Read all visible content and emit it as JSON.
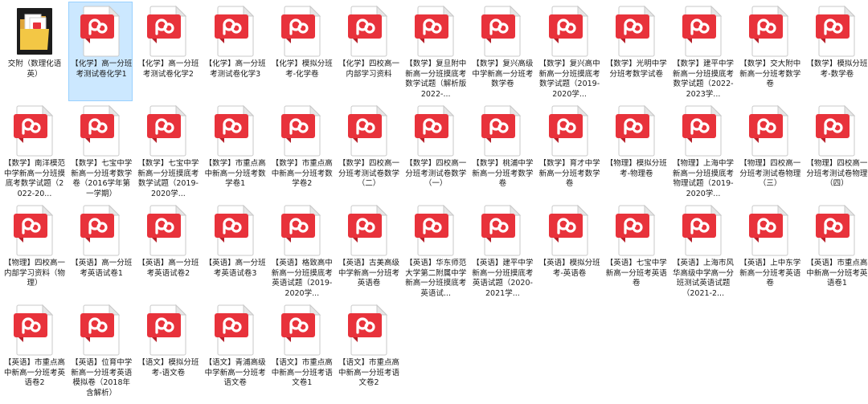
{
  "icons": {
    "folder": "folder-icon",
    "pdf": "pdf-file-icon"
  },
  "colors": {
    "pdf_red": "#e8323b",
    "selection_bg": "#cce8ff",
    "folder_yellow": "#f3c745"
  },
  "items": [
    {
      "label": "交附（数理化语英）",
      "type": "folder",
      "selected": false
    },
    {
      "label": "【化学】高一分班考测试卷化学1",
      "type": "pdf",
      "selected": true
    },
    {
      "label": "【化学】高一分班考测试卷化学2",
      "type": "pdf",
      "selected": false
    },
    {
      "label": "【化学】高一分班考测试卷化学3",
      "type": "pdf",
      "selected": false
    },
    {
      "label": "【化学】模拟分班考-化学卷",
      "type": "pdf",
      "selected": false
    },
    {
      "label": "【化学】四校高一内部学习资料",
      "type": "pdf",
      "selected": false
    },
    {
      "label": "【数学】复旦附中新高一分班摸底考数学试题（解析版2022-...",
      "type": "pdf",
      "selected": false
    },
    {
      "label": "【数学】复兴高级中学新高一分班考数学卷",
      "type": "pdf",
      "selected": false
    },
    {
      "label": "【数学】复兴高中新高一分班摸底考数学试题（2019-2020学...",
      "type": "pdf",
      "selected": false
    },
    {
      "label": "【数学】光明中学分班考数学试卷",
      "type": "pdf",
      "selected": false
    },
    {
      "label": "【数学】建平中学新高一分班摸底考数学试题（2022-2023学...",
      "type": "pdf",
      "selected": false
    },
    {
      "label": "【数学】交大附中新高一分班考数学卷",
      "type": "pdf",
      "selected": false
    },
    {
      "label": "【数学】模拟分班考-数学卷",
      "type": "pdf",
      "selected": false
    },
    {
      "label": "【数学】南洋模范中学新高一分班摸底考数学试题（2022-20...",
      "type": "pdf",
      "selected": false
    },
    {
      "label": "【数学】七宝中学新高一分班考数学卷（2016学年第一学期）",
      "type": "pdf",
      "selected": false
    },
    {
      "label": "【数学】七宝中学新高一分班摸底考数学试题（2019-2020学...",
      "type": "pdf",
      "selected": false
    },
    {
      "label": "【数学】市重点高中新高一分班考数学卷1",
      "type": "pdf",
      "selected": false
    },
    {
      "label": "【数学】市重点高中新高一分班考数学卷2",
      "type": "pdf",
      "selected": false
    },
    {
      "label": "【数学】四校高一分班考测试卷数学（二）",
      "type": "pdf",
      "selected": false
    },
    {
      "label": "【数学】四校高一分班考测试卷数学（一）",
      "type": "pdf",
      "selected": false
    },
    {
      "label": "【数学】桃浦中学新高一分班考数学卷",
      "type": "pdf",
      "selected": false
    },
    {
      "label": "【数学】育才中学新高一分班考数学卷",
      "type": "pdf",
      "selected": false
    },
    {
      "label": "【物理】模拟分班考-物理卷",
      "type": "pdf",
      "selected": false
    },
    {
      "label": "【物理】上海中学新高一分班摸底考物理试题（2019-2020学...",
      "type": "pdf",
      "selected": false
    },
    {
      "label": "【物理】四校高一分班考测试卷物理（三）",
      "type": "pdf",
      "selected": false
    },
    {
      "label": "【物理】四校高一分班考测试卷物理（四）",
      "type": "pdf",
      "selected": false
    },
    {
      "label": "【物理】四校高一内部学习资料（物理）",
      "type": "pdf",
      "selected": false
    },
    {
      "label": "【英语】高一分班考英语试卷1",
      "type": "pdf",
      "selected": false
    },
    {
      "label": "【英语】高一分班考英语试卷2",
      "type": "pdf",
      "selected": false
    },
    {
      "label": "【英语】高一分班考英语试卷3",
      "type": "pdf",
      "selected": false
    },
    {
      "label": "【英语】格致高中新高一分班摸底考英语试题（2019-2020学...",
      "type": "pdf",
      "selected": false
    },
    {
      "label": "【英语】古美高级中学新高一分班考英语卷",
      "type": "pdf",
      "selected": false
    },
    {
      "label": "【英语】华东师范大学第二附属中学新高一分班摸底考英语试...",
      "type": "pdf",
      "selected": false
    },
    {
      "label": "【英语】建平中学新高一分班摸底考英语试题（2020-2021学...",
      "type": "pdf",
      "selected": false
    },
    {
      "label": "【英语】模拟分班考-英语卷",
      "type": "pdf",
      "selected": false
    },
    {
      "label": "【英语】七宝中学新高一分班考英语卷",
      "type": "pdf",
      "selected": false
    },
    {
      "label": "【英语】上海市风华高级中学高一分班测试英语试题（2021-2...",
      "type": "pdf",
      "selected": false
    },
    {
      "label": "【英语】上中东学新高一分班考英语卷",
      "type": "pdf",
      "selected": false
    },
    {
      "label": "【英语】市重点高中新高一分班考英语卷1",
      "type": "pdf",
      "selected": false
    },
    {
      "label": "【英语】市重点高中新高一分班考英语卷2",
      "type": "pdf",
      "selected": false
    },
    {
      "label": "【英语】位育中学新高一分班考英语模拟卷（2018年 含解析）",
      "type": "pdf",
      "selected": false
    },
    {
      "label": "【语文】模拟分班考-语文卷",
      "type": "pdf",
      "selected": false
    },
    {
      "label": "【语文】青浦高级中学新高一分班考语文卷",
      "type": "pdf",
      "selected": false
    },
    {
      "label": "【语文】市重点高中新高一分班考语文卷1",
      "type": "pdf",
      "selected": false
    },
    {
      "label": "【语文】市重点高中新高一分班考语文卷2",
      "type": "pdf",
      "selected": false
    }
  ]
}
